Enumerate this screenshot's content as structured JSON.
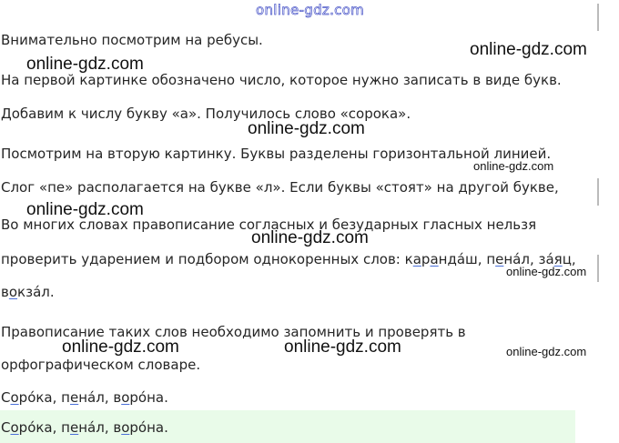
{
  "watermark_top": "online-gdz.com",
  "watermark": "online-gdz.com",
  "lines": [
    "Внимательно посмотрим на ребусы.",
    "На первой картинке обозначено число, которое нужно записать в виде букв.",
    "Добавим к числу букву «а». Получилось слово «сорока».",
    "Посмотрим на вторую картинку. Буквы разделены горизонтальной линией.",
    "Слог «пе» располагается на букве «л». Если буквы «стоят» на другой букве,",
    "Во многих словах правописание согласных и безударных гласных нельзя",
    "проверить ударением и подбором однокоренных слов:",
    "Правописание таких слов необходимо запомнить и проверять в",
    "орфографическом словаре."
  ],
  "examples": {
    "w1": [
      "к",
      "а",
      "р",
      "а",
      "нда́ш"
    ],
    "w2": [
      "п",
      "е",
      "на́л"
    ],
    "w3": [
      "за́",
      "я",
      "ц"
    ],
    "w4": [
      "в",
      "о",
      "кза́л."
    ]
  },
  "answer": {
    "w1": [
      "С",
      "о",
      "ро́ка"
    ],
    "w2": [
      "п",
      "е",
      "на́л"
    ],
    "w3": [
      "в",
      "о",
      "ро́на."
    ]
  }
}
